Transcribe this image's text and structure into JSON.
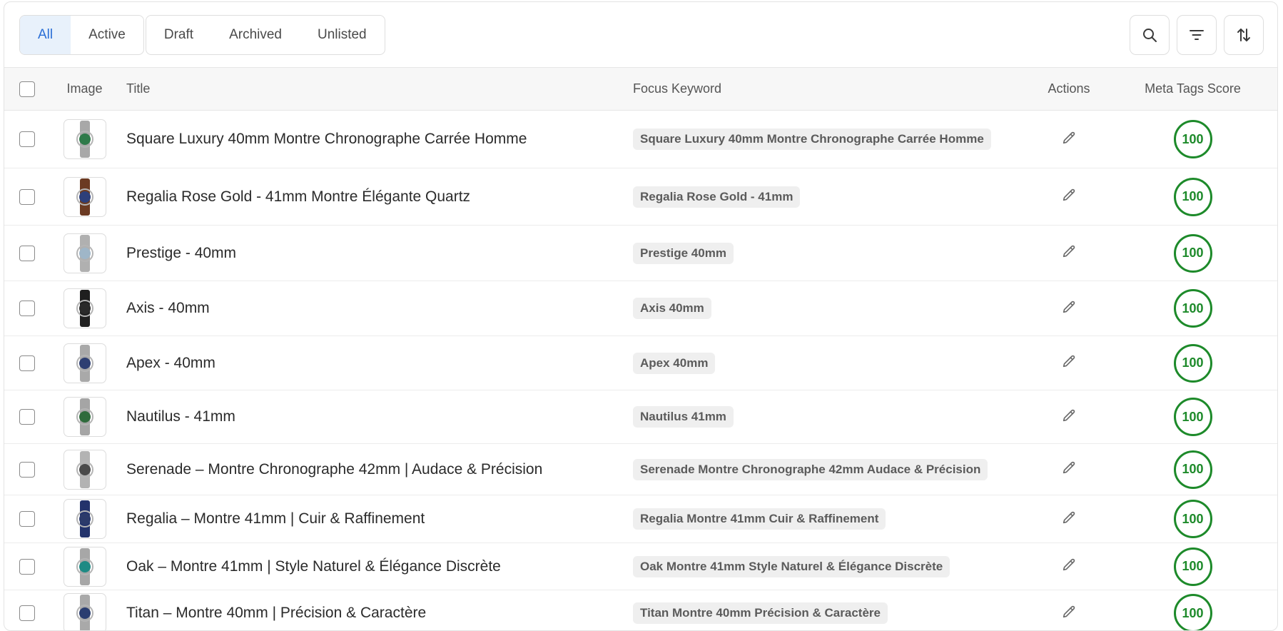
{
  "tabs": [
    {
      "label": "All",
      "active": true
    },
    {
      "label": "Active",
      "active": false
    },
    {
      "label": "Draft",
      "active": false
    },
    {
      "label": "Archived",
      "active": false
    },
    {
      "label": "Unlisted",
      "active": false
    }
  ],
  "toolbar": {
    "icons": [
      "search-icon",
      "filter-icon",
      "sort-icon"
    ]
  },
  "columns": {
    "image": "Image",
    "title": "Title",
    "focus_keyword": "Focus Keyword",
    "actions": "Actions",
    "meta_score": "Meta Tags Score"
  },
  "colors": {
    "accent": "#2a6fd6",
    "score_green": "#1d8a2a"
  },
  "rows": [
    {
      "title": "Square Luxury 40mm Montre Chronographe Carrée Homme",
      "keyword": "Square Luxury 40mm Montre Chronographe Carrée Homme",
      "score": "100",
      "strap": "#a8a8a8",
      "dial": "#2f7a4a"
    },
    {
      "title": "Regalia Rose Gold - 41mm Montre Élégante Quartz",
      "keyword": "Regalia Rose Gold - 41mm",
      "score": "100",
      "strap": "#6b3a22",
      "dial": "#2d3f7a"
    },
    {
      "title": "Prestige - 40mm",
      "keyword": "Prestige 40mm",
      "score": "100",
      "strap": "#b0b0b0",
      "dial": "#9fb6c8"
    },
    {
      "title": "Axis - 40mm",
      "keyword": "Axis 40mm",
      "score": "100",
      "strap": "#1f1f1f",
      "dial": "#2a2a2a"
    },
    {
      "title": "Apex - 40mm",
      "keyword": "Apex 40mm",
      "score": "100",
      "strap": "#a9a9a9",
      "dial": "#2e3f72"
    },
    {
      "title": "Nautilus - 41mm",
      "keyword": "Nautilus 41mm",
      "score": "100",
      "strap": "#a5a5a5",
      "dial": "#2f6b3c"
    },
    {
      "title": "Serenade – Montre Chronographe 42mm | Audace & Précision",
      "keyword": "Serenade Montre Chronographe 42mm Audace & Précision",
      "score": "100",
      "strap": "#b3b3b3",
      "dial": "#4a4a4a"
    },
    {
      "title": "Regalia – Montre 41mm | Cuir & Raffinement",
      "keyword": "Regalia Montre 41mm Cuir & Raffinement",
      "score": "100",
      "strap": "#23336b",
      "dial": "#2b3a6a"
    },
    {
      "title": "Oak – Montre 41mm | Style Naturel & Élégance Discrète",
      "keyword": "Oak Montre 41mm Style Naturel & Élégance Discrète",
      "score": "100",
      "strap": "#a7a7a7",
      "dial": "#1e8a84"
    },
    {
      "title": "Titan – Montre 40mm | Précision & Caractère",
      "keyword": "Titan Montre 40mm Précision & Caractère",
      "score": "100",
      "strap": "#a9a9a9",
      "dial": "#2a3d70"
    }
  ]
}
